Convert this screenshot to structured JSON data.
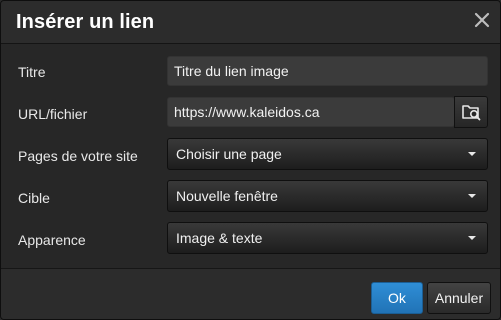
{
  "dialog": {
    "title": "Insérer un lien",
    "close_icon": "close-icon"
  },
  "form": {
    "title_label": "Titre",
    "title_value": "Titre du lien image",
    "url_label": "URL/fichier",
    "url_value": "https://www.kaleidos.ca",
    "browse_icon": "folder-search-icon",
    "pages_label": "Pages de votre site",
    "pages_value": "Choisir une page",
    "target_label": "Cible",
    "target_value": "Nouvelle fenêtre",
    "appearance_label": "Apparence",
    "appearance_value": "Image & texte"
  },
  "footer": {
    "ok_label": "Ok",
    "cancel_label": "Annuler"
  },
  "colors": {
    "accent": "#2680c8",
    "background": "#272727",
    "field": "#3b3b3b"
  }
}
